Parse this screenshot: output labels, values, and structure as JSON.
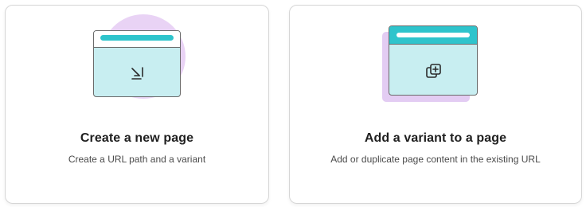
{
  "cards": [
    {
      "title": "Create a new page",
      "subtitle": "Create a URL path and a variant",
      "icon": "new-page-arrow-icon"
    },
    {
      "title": "Add a variant to a page",
      "subtitle": "Add or duplicate page content in the existing URL",
      "icon": "duplicate-plus-icon"
    }
  ],
  "colors": {
    "teal": "#2ec4cc",
    "light_teal": "#c8eef1",
    "lavender": "#e9d3f5",
    "border": "#d6d6d6",
    "outline": "#6a6a6a"
  }
}
